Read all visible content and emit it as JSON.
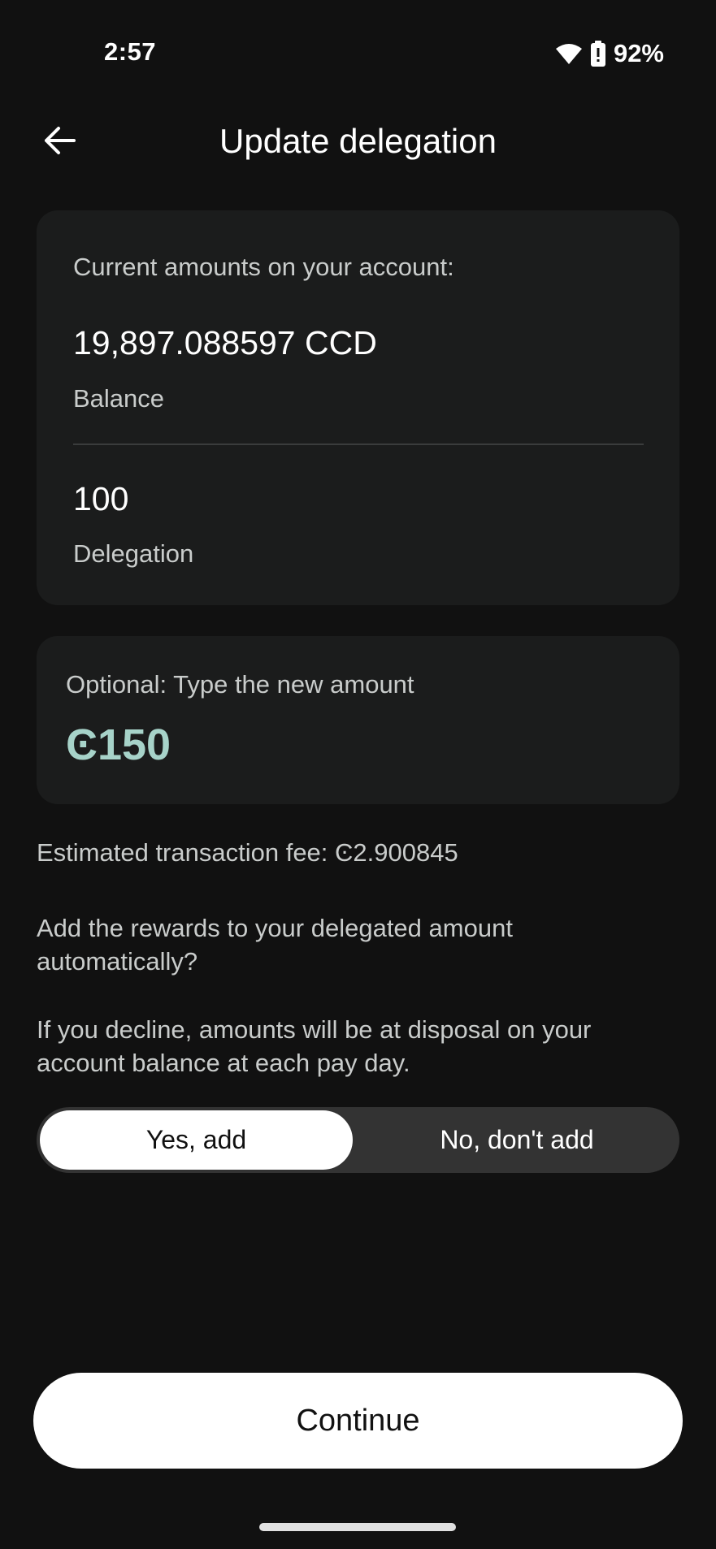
{
  "status_bar": {
    "time": "2:57",
    "battery_percent": "92%",
    "icons": [
      "wifi-icon",
      "battery-icon"
    ]
  },
  "header": {
    "title": "Update delegation",
    "back_icon": "arrow-left-icon"
  },
  "account_card": {
    "label": "Current amounts on your account:",
    "balance_value": "19,897.088597 CCD",
    "balance_label": "Balance",
    "delegation_value": "100",
    "delegation_label": "Delegation"
  },
  "amount_card": {
    "label": "Optional: Type the new amount",
    "value": "Ͼ150"
  },
  "fee_text": "Estimated transaction fee: Ͼ2.900845",
  "rewards_question": "Add the rewards to your delegated amount automatically?",
  "rewards_note": "If you decline, amounts will be at disposal on your account balance at each pay day.",
  "rewards_toggle": {
    "yes_label": "Yes, add",
    "no_label": "No, don't add",
    "selected": "yes"
  },
  "continue_label": "Continue",
  "colors": {
    "background": "#111111",
    "card": "#1b1c1c",
    "accent_amount": "#a7d3c9",
    "secondary_text": "#c9cccb"
  }
}
